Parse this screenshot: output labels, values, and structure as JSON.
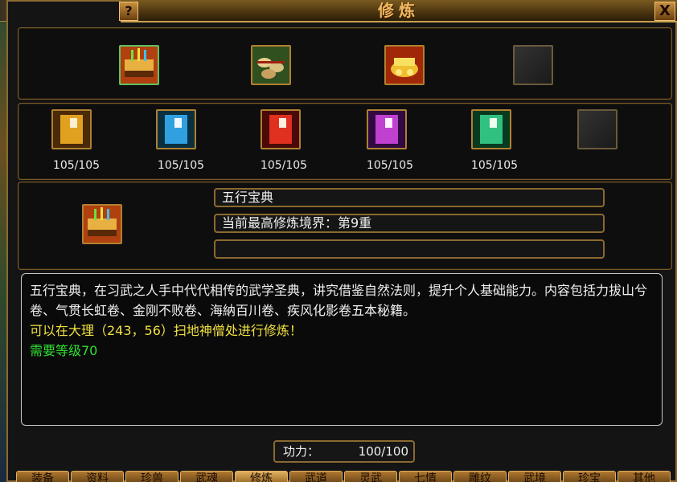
{
  "window": {
    "title": "修炼",
    "help_label": "?",
    "close_label": "X"
  },
  "top_slots": [
    {
      "icon": "golden-manual-icon",
      "selected": true
    },
    {
      "icon": "scroll-bundle-icon",
      "selected": false
    },
    {
      "icon": "gold-treasure-pile-icon",
      "selected": false
    },
    {
      "icon": "empty-slot",
      "selected": false
    }
  ],
  "books": [
    {
      "icon": "yellow-book-icon",
      "color": "#e0a020",
      "count": "105/105"
    },
    {
      "icon": "blue-book-icon",
      "color": "#30a0e0",
      "count": "105/105"
    },
    {
      "icon": "red-book-icon",
      "color": "#e03020",
      "count": "105/105"
    },
    {
      "icon": "purple-book-icon",
      "color": "#c040d0",
      "count": "105/105"
    },
    {
      "icon": "green-book-icon",
      "color": "#30c080",
      "count": "105/105"
    },
    {
      "icon": "empty-slot",
      "color": "#222222",
      "count": ""
    }
  ],
  "info": {
    "icon": "golden-manual-icon",
    "name": "五行宝典",
    "realm": "当前最高修炼境界：第9重",
    "extra": ""
  },
  "description": {
    "text": "五行宝典，在习武之人手中代代相传的武学圣典，讲究借鉴自然法则，提升个人基础能力。内容包括力拔山兮卷、气贯长虹卷、金刚不败卷、海納百川卷、疾风化影卷五本秘籍。",
    "location": "可以在大理（243，56）扫地神僧处进行修炼！",
    "requirement": "需要等级70"
  },
  "power": {
    "label": "功力：",
    "value": "100/100"
  },
  "tabs": [
    "装备",
    "资料",
    "珍兽",
    "武魂",
    "修炼",
    "武道",
    "灵武",
    "七情",
    "雕纹",
    "武境",
    "珍宝",
    "其他"
  ],
  "colors": {
    "location_text": "#f0e040",
    "requirement_text": "#30e030",
    "border": "#8a6a30",
    "title": "#f0b860"
  }
}
